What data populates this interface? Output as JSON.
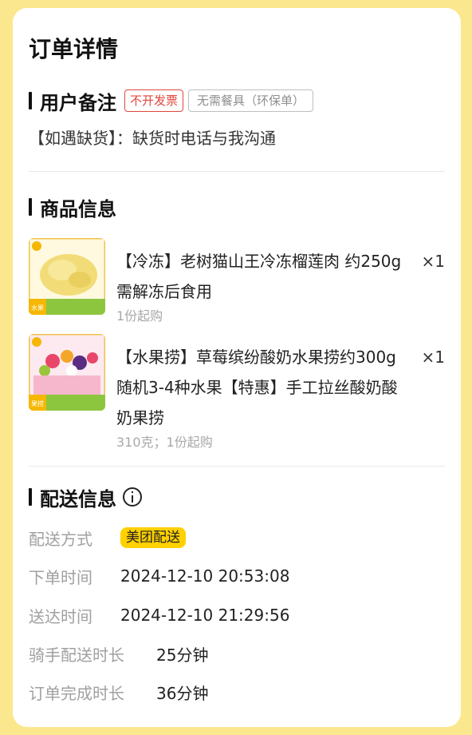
{
  "page": {
    "title": "订单详情"
  },
  "remarks": {
    "title": "用户备注",
    "tags": [
      "不开发票",
      "无需餐具（环保单）"
    ],
    "text": "【如遇缺货】：缺货时电话与我沟通"
  },
  "products": {
    "title": "商品信息",
    "items": [
      {
        "name": "【冷冻】老树猫山王冷冻榴莲肉 约250g 需解冻后食用",
        "qty": "×1",
        "sub": "1份起购",
        "thumb_badge": "水果",
        "thumb_colors": {
          "bg": "#fff9e0",
          "fruit": "#f2dc78",
          "band": "#8cc63f"
        }
      },
      {
        "name": "【水果捞】草莓缤纷酸奶水果捞约300g随机3-4种水果【特惠】手工拉丝酸奶酸奶果捞",
        "qty": "×1",
        "sub": "310克；1份起购",
        "thumb_badge": "果捞",
        "thumb_colors": {
          "bg": "#fde9f0",
          "fruit": "#e8476a",
          "band": "#8cc63f"
        }
      }
    ]
  },
  "delivery": {
    "title": "配送信息",
    "rows": [
      {
        "label": "配送方式",
        "value": "美团配送"
      },
      {
        "label": "下单时间",
        "value": "2024-12-10 20:53:08"
      },
      {
        "label": "送达时间",
        "value": "2024-12-10 21:29:56"
      },
      {
        "label": "骑手配送时长",
        "value": "25分钟"
      },
      {
        "label": "订单完成时长",
        "value": "36分钟"
      }
    ]
  },
  "colors": {
    "background": "#fbe78e",
    "delivery_chip": "#ffd100",
    "tag_red": "#e0473c"
  }
}
